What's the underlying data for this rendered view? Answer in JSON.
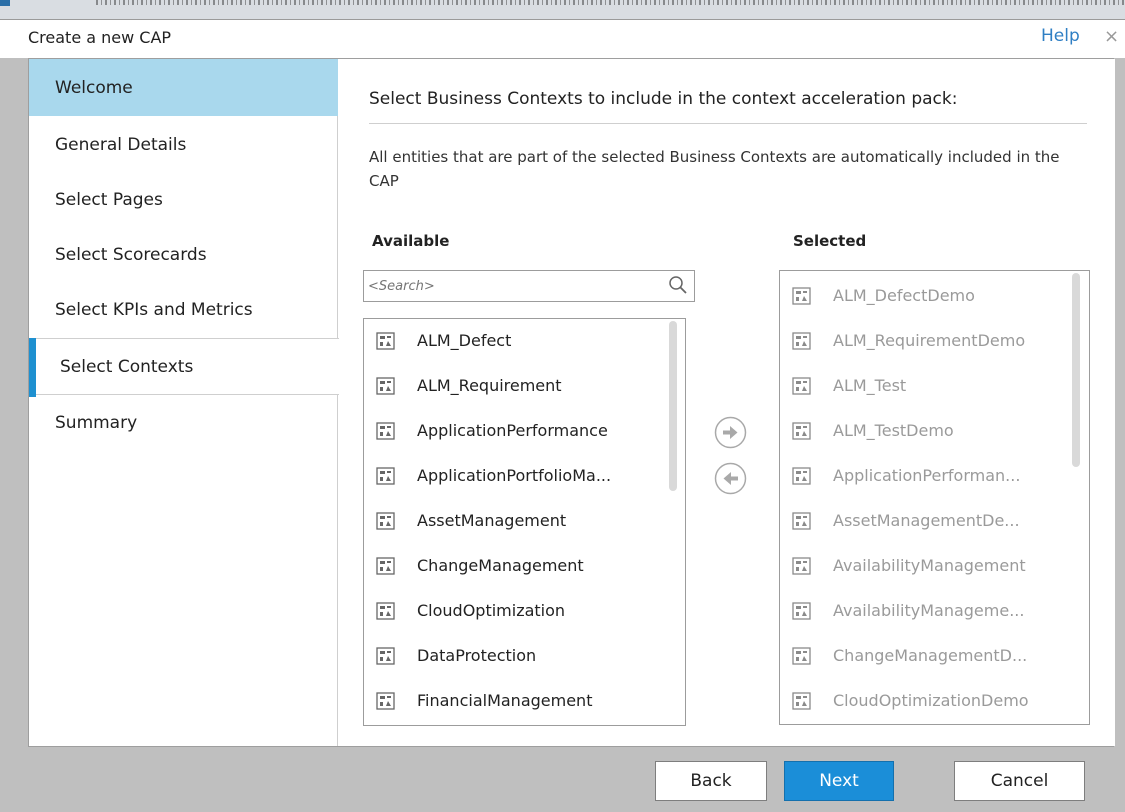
{
  "dialog": {
    "title": "Create a new CAP",
    "help_label": "Help",
    "close_glyph": "×"
  },
  "sidebar": {
    "items": [
      {
        "label": "Welcome",
        "state": "highlighted"
      },
      {
        "label": "General Details",
        "state": "normal"
      },
      {
        "label": "Select Pages",
        "state": "normal"
      },
      {
        "label": "Select Scorecards",
        "state": "normal"
      },
      {
        "label": "Select KPIs and Metrics",
        "state": "normal"
      },
      {
        "label": "Select Contexts",
        "state": "active"
      },
      {
        "label": "Summary",
        "state": "normal"
      }
    ]
  },
  "main": {
    "heading": "Select Business Contexts to include in the context acceleration pack:",
    "description": "All entities that are part of the selected Business Contexts are automatically included in the CAP",
    "available": {
      "label": "Available",
      "search_placeholder": "<Search>",
      "items": [
        "ALM_Defect",
        "ALM_Requirement",
        "ApplicationPerformance",
        "ApplicationPortfolioMa...",
        "AssetManagement",
        "ChangeManagement",
        "CloudOptimization",
        "DataProtection",
        "FinancialManagement"
      ]
    },
    "selected": {
      "label": "Selected",
      "items": [
        "ALM_DefectDemo",
        "ALM_RequirementDemo",
        "ALM_Test",
        "ALM_TestDemo",
        "ApplicationPerforman...",
        "AssetManagementDe...",
        "AvailabilityManagement",
        "AvailabilityManageme...",
        "ChangeManagementD...",
        "CloudOptimizationDemo"
      ]
    }
  },
  "footer": {
    "back_label": "Back",
    "next_label": "Next",
    "cancel_label": "Cancel"
  },
  "colors": {
    "accent": "#1b8ed8",
    "sidebar_highlight": "#a9d8ed",
    "active_marker": "#1e90d0",
    "help_link": "#2f7fc4"
  }
}
